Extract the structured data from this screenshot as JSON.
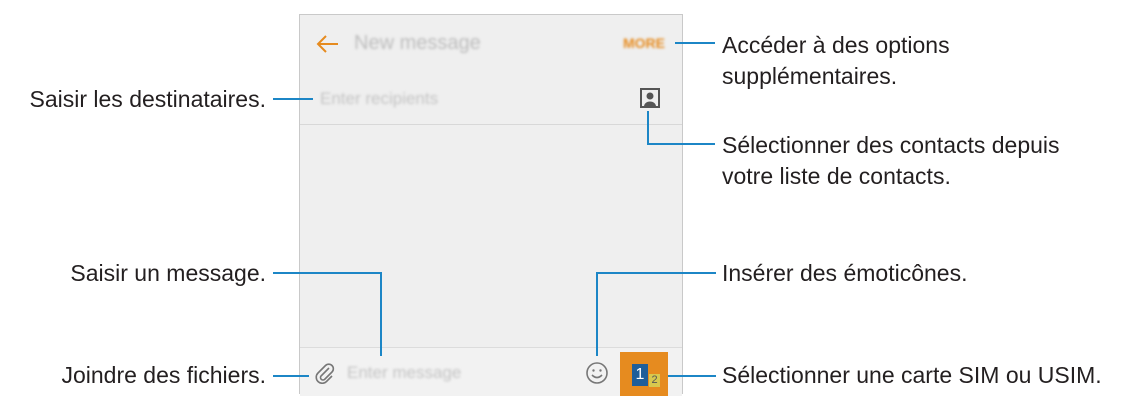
{
  "screen": {
    "title": "New message",
    "more_label": "MORE",
    "recipient_placeholder": "Enter recipients",
    "message_placeholder": "Enter message",
    "sim_primary": "1",
    "sim_secondary": "2"
  },
  "annotations": {
    "left": {
      "recipients": "Saisir les destinataires.",
      "message": "Saisir un message.",
      "attach": "Joindre des fichiers."
    },
    "right": {
      "more_line1": "Accéder à des options",
      "more_line2": "supplémentaires.",
      "contacts_line1": "Sélectionner des contacts depuis",
      "contacts_line2": "votre liste de contacts.",
      "emoticons": "Insérer des émoticônes.",
      "sim": "Sélectionner une carte SIM ou USIM."
    }
  },
  "colors": {
    "accent": "#e68b1f",
    "callout_line": "#1c86c6",
    "screen_bg": "#efefef"
  }
}
